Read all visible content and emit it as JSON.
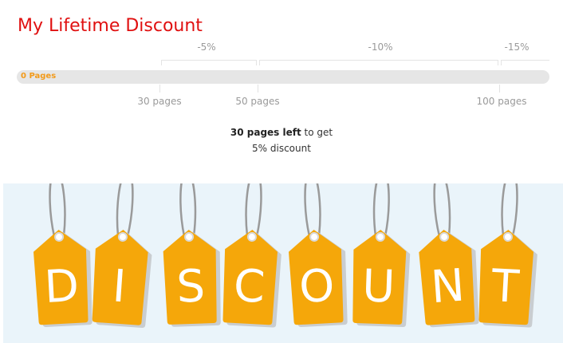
{
  "title": "My Lifetime Discount",
  "progress": {
    "current_label": "0 Pages",
    "current_pages": 0,
    "fraction": 0
  },
  "tiers": [
    {
      "label": "-5%"
    },
    {
      "label": "-10%"
    },
    {
      "label": "-15%"
    }
  ],
  "milestones": [
    {
      "label": "30 pages"
    },
    {
      "label": "50 pages"
    },
    {
      "label": "100 pages"
    }
  ],
  "message": {
    "bold": "30 pages left",
    "rest": " to get",
    "line2": "5% discount"
  },
  "banner": {
    "letters": [
      "D",
      "I",
      "S",
      "C",
      "O",
      "U",
      "N",
      "T"
    ],
    "tag_color": "#f5a70a",
    "string_color": "#9a9a9a"
  }
}
